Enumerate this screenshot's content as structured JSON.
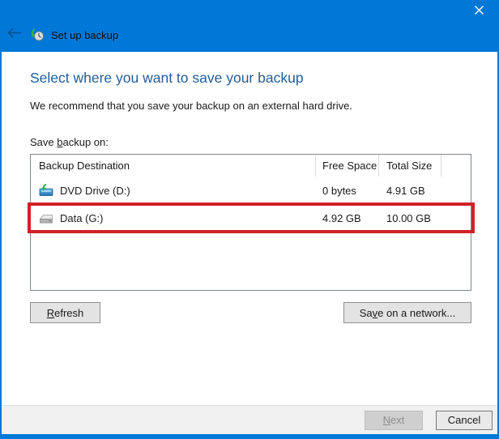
{
  "colors": {
    "accent_blue": "#0078d7",
    "heading_blue": "#1f5d9b",
    "annotation_red": "#cf2127"
  },
  "titlebar": {
    "title": "Set up backup",
    "back_icon": "back-arrow",
    "close_icon": "close-x",
    "app_icon": "backup-clock-with-green-arrow"
  },
  "content": {
    "heading": "Select where you want to save your backup",
    "subtext": "We recommend that you save your backup on an external hard drive.",
    "save_label": {
      "pre": "Save ",
      "ak": "b",
      "post": "ackup on:"
    }
  },
  "list": {
    "columns": [
      "Backup Destination",
      "Free Space",
      "Total Size"
    ],
    "rows": [
      {
        "icon": "dvd-drive",
        "name": "DVD Drive (D:)",
        "free": "0 bytes",
        "total": "4.91 GB"
      },
      {
        "icon": "hard-drive",
        "name": "Data (G:)",
        "free": "4.92 GB",
        "total": "10.00 GB",
        "annotated": true
      }
    ]
  },
  "buttons": {
    "refresh": {
      "pre": "",
      "ak": "R",
      "post": "efresh"
    },
    "save_network": {
      "pre": "Sa",
      "ak": "v",
      "post": "e on a network..."
    },
    "next": {
      "pre": "",
      "ak": "N",
      "post": "ext"
    },
    "cancel": "Cancel"
  }
}
